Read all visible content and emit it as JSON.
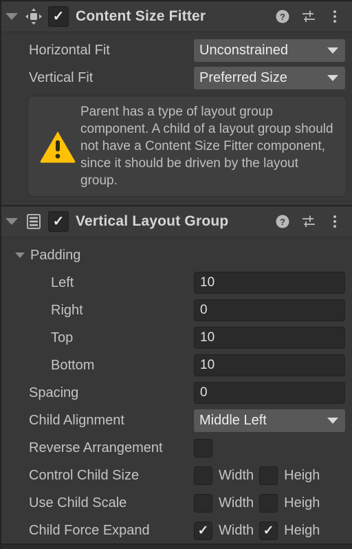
{
  "components": [
    {
      "id": "content-size-fitter",
      "title": "Content Size Fitter",
      "enabled_mark": "✓",
      "icon": "content-size-fitter-icon",
      "foldout": "▼",
      "header_icons": [
        "help-icon",
        "preset-icon",
        "more-menu-icon"
      ],
      "rows": [
        {
          "label": "Horizontal Fit",
          "type": "dropdown",
          "value": "Unconstrained"
        },
        {
          "label": "Vertical Fit",
          "type": "dropdown",
          "value": "Preferred Size"
        }
      ],
      "warning": {
        "icon": "warning-triangle-icon",
        "text": "Parent has a type of layout group component. A child of a layout group should not have a Content Size Fitter component, since it should be driven by the layout group."
      }
    },
    {
      "id": "vertical-layout-group",
      "title": "Vertical Layout Group",
      "enabled_mark": "✓",
      "icon": "vertical-layout-group-icon",
      "foldout": "▼",
      "header_icons": [
        "help-icon",
        "preset-icon",
        "more-menu-icon"
      ],
      "padding_group_label": "Padding",
      "rows": [
        {
          "label": "Left",
          "type": "number",
          "value": "10",
          "indent": 1
        },
        {
          "label": "Right",
          "type": "number",
          "value": "0",
          "indent": 1
        },
        {
          "label": "Top",
          "type": "number",
          "value": "10",
          "indent": 1
        },
        {
          "label": "Bottom",
          "type": "number",
          "value": "10",
          "indent": 1
        },
        {
          "label": "Spacing",
          "type": "number",
          "value": "0",
          "indent": 0
        },
        {
          "label": "Child Alignment",
          "type": "dropdown",
          "value": "Middle Left",
          "indent": 0
        },
        {
          "label": "Reverse Arrangement",
          "type": "checkbox",
          "checked": false,
          "indent": 0
        },
        {
          "label": "Control Child Size",
          "type": "checkbox-pair",
          "indent": 0,
          "pair": [
            {
              "label": "Width",
              "checked": false
            },
            {
              "label": "Heigh",
              "checked": false
            }
          ]
        },
        {
          "label": "Use Child Scale",
          "type": "checkbox-pair",
          "indent": 0,
          "pair": [
            {
              "label": "Width",
              "checked": false
            },
            {
              "label": "Heigh",
              "checked": false
            }
          ]
        },
        {
          "label": "Child Force Expand",
          "type": "checkbox-pair",
          "indent": 0,
          "pair": [
            {
              "label": "Width",
              "checked": true
            },
            {
              "label": "Heigh",
              "checked": true
            }
          ]
        }
      ]
    }
  ],
  "colors": {
    "panel_bg": "#383838",
    "header_bg": "#3B3B3B",
    "field_bg": "#2A2A2A",
    "dropdown_bg": "#585858",
    "label_text": "#C4C4C4",
    "title_text": "#D6D6D6",
    "warning_yellow": "#FFC107",
    "border_dark": "#232323"
  },
  "checkmark": "✓"
}
